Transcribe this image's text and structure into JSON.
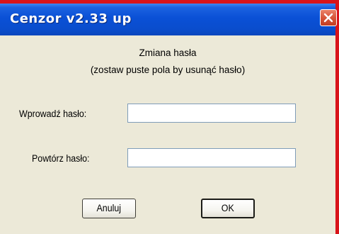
{
  "window": {
    "title": "Cenzor v2.33 up",
    "close_icon": "close-icon"
  },
  "dialog": {
    "heading": "Zmiana hasła",
    "hint": "(zostaw puste pola by usunąć hasło)",
    "password_label": "Wprowadź hasło:",
    "password_value": "",
    "repeat_label": "Powtórz hasło:",
    "repeat_value": "",
    "cancel_label": "Anuluj",
    "ok_label": "OK"
  },
  "colors": {
    "titlebar": "#0a50d6",
    "close_button": "#d8563a",
    "dialog_background": "#ece9d8"
  }
}
